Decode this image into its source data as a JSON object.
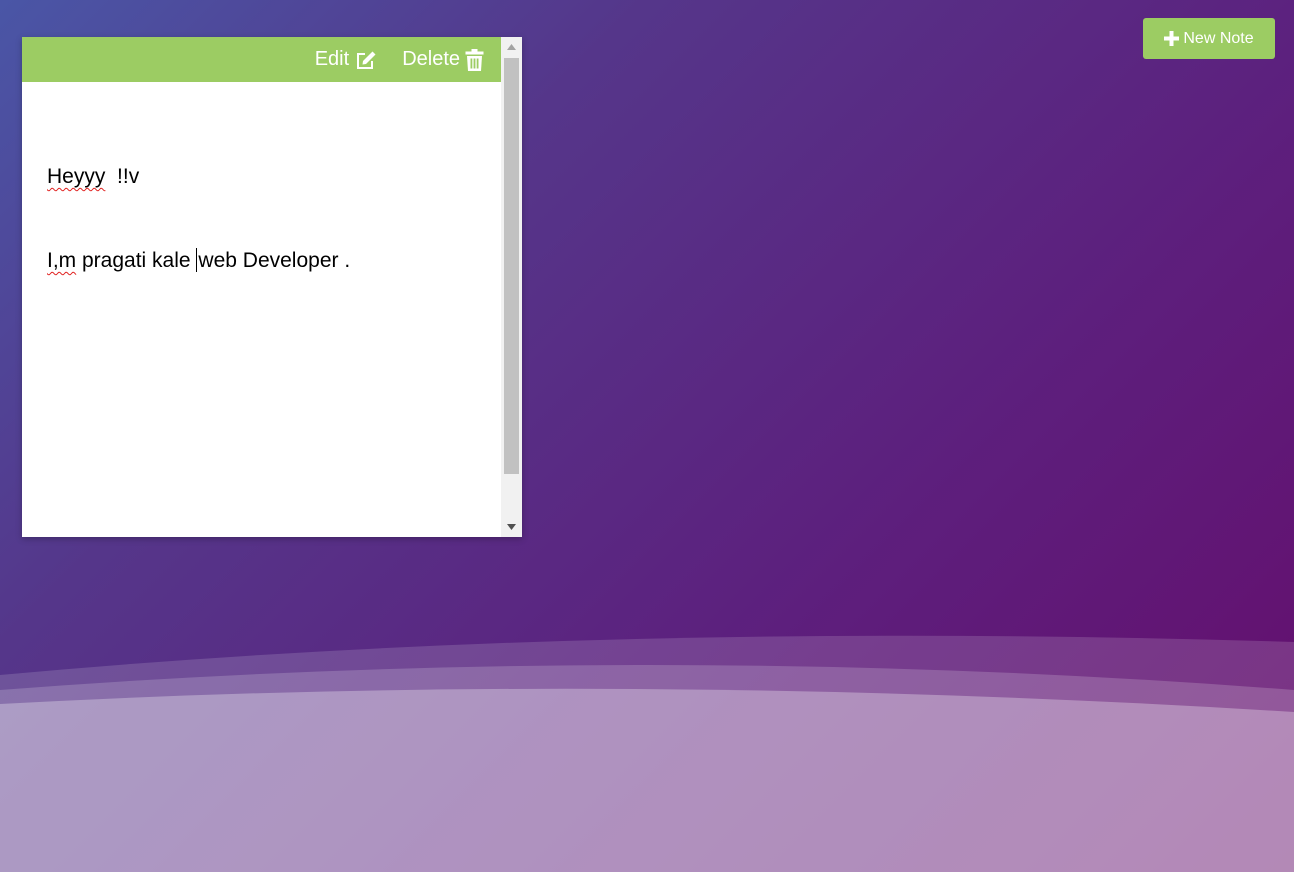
{
  "header": {
    "new_note_label": "New Note",
    "new_note_icon": "plus-icon"
  },
  "note": {
    "edit_label": "Edit",
    "edit_icon": "edit-icon",
    "delete_label": "Delete",
    "delete_icon": "trash-icon",
    "line1_word": "Heyyy",
    "line1_rest": "  !!v",
    "line2_word": "I,m",
    "line2_before_caret": " pragati kale ",
    "line2_after_caret": "web Developer ."
  },
  "colors": {
    "accent_green": "#9ccc63",
    "background_start": "#4a56a6",
    "background_end": "#650d6c",
    "spellcheck": "#e0201e"
  }
}
